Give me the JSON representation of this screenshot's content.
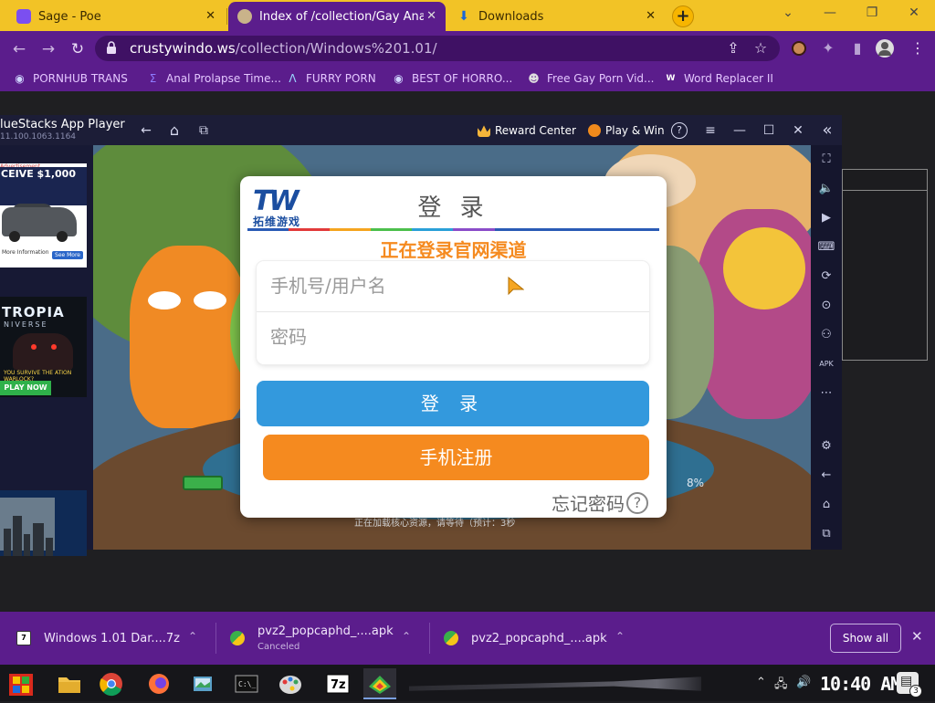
{
  "browser": {
    "tabs": [
      {
        "title": "Sage - Poe",
        "active": false
      },
      {
        "title": "Index of /collection/Gay Anal P",
        "active": true
      },
      {
        "title": "Downloads",
        "active": false
      }
    ],
    "new_tab": "+",
    "window_controls": {
      "minimize": "—",
      "maximize": "❐",
      "close": "✕"
    }
  },
  "toolbar": {
    "back": "←",
    "forward": "→",
    "reload": "↻",
    "url_host": "crustywindo.ws",
    "url_path": "/collection/Windows%201.01/",
    "share": "⇪",
    "star": "☆",
    "extensions": "✦",
    "sidepanel": "▮",
    "profile": "●",
    "menu": "⋮"
  },
  "bookmarks": [
    {
      "label": "PORNHUB TRANS",
      "icon": "globe-icon",
      "glyph": "◉",
      "color": "#cfd6ff"
    },
    {
      "label": "Anal Prolapse Time...",
      "icon": "sigma-icon",
      "glyph": "Σ",
      "color": "#8e7bff"
    },
    {
      "label": "FURRY PORN",
      "icon": "lambda-icon",
      "glyph": "Λ",
      "color": "#9ad8ff"
    },
    {
      "label": "BEST OF HORRO...",
      "icon": "globe-icon",
      "glyph": "◉",
      "color": "#cfd6ff"
    },
    {
      "label": "Free Gay Porn Vid...",
      "icon": "skull-icon",
      "glyph": "☻",
      "color": "#e0e0e0"
    },
    {
      "label": "Word Replacer II",
      "icon": "wr-icon",
      "glyph": "W",
      "color": "#ffffff"
    }
  ],
  "bluestacks": {
    "title": "lueStacks App Player",
    "version": "11.100.1063.1164",
    "reward_center": "Reward Center",
    "play_win": "Play & Win",
    "controls": {
      "back": "←",
      "home": "⌂",
      "recents": "⧉",
      "help": "?",
      "menu": "≡",
      "minimize": "—",
      "maximize": "☐",
      "close": "✕",
      "collapse": "«"
    },
    "sidebar_icons": [
      "⛶",
      "🔈",
      "▶",
      "⌨",
      "⟳",
      "⊙",
      "⚇",
      "APK",
      "⋯",
      "⚙",
      "←",
      "⌂",
      "⧉"
    ],
    "ads": {
      "ad1_label": "Advertisement",
      "ad1_head": "CEIVE $1,000",
      "ad1_more": "More Information",
      "ad1_cta": "See More",
      "ad2_title": "TROPIA",
      "ad2_sub": "NIVERSE",
      "ad2_tag": "YOU SURVIVE THE ATION WARLOCK?",
      "ad2_cta": "PLAY NOW"
    },
    "game": {
      "loading_text": "正在加载核心资源，请等待（预计：3秒",
      "percent": "8%"
    }
  },
  "login_dialog": {
    "logo_mark": "TW",
    "logo_text": "拓维游戏",
    "title": "登 录",
    "subtitle": "正在登录官网渠道",
    "username_placeholder": "手机号/用户名",
    "password_placeholder": "密码",
    "login_button": "登 录",
    "register_button": "手机注册",
    "forgot_link": "忘记密码",
    "forgot_icon": "?",
    "accent_colors": {
      "blue": "#3399dd",
      "orange": "#f58a1f"
    }
  },
  "downloads": {
    "items": [
      {
        "name": "Windows 1.01 Dar....7z",
        "status": ""
      },
      {
        "name": "pvz2_popcaphd_....apk",
        "status": "Canceled"
      },
      {
        "name": "pvz2_popcaphd_....apk",
        "status": ""
      }
    ],
    "show_all": "Show all",
    "close": "✕"
  },
  "taskbar": {
    "clock": "10:40 AM",
    "notifications": "3"
  }
}
